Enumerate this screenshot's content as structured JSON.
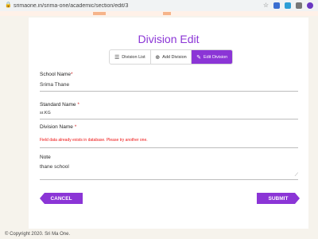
{
  "browser": {
    "url": "srimaone.in/srima-one/academic/section/edit/3"
  },
  "page": {
    "title": "Division Edit",
    "tabs": [
      {
        "label": "Division List",
        "icon": "list-icon"
      },
      {
        "label": "Add Division",
        "icon": "plus-circle-icon"
      },
      {
        "label": "Edit Division",
        "icon": "edit-icon"
      }
    ],
    "fields": {
      "school_name": {
        "label": "School Name",
        "required": "*",
        "value": "Srima Thane"
      },
      "standard_name": {
        "label": "Standard Name",
        "required": "*",
        "value": "sr.KG"
      },
      "division_name": {
        "label": "Division Name",
        "required": "*",
        "error": "Field data already exists in database. Please try another one."
      },
      "note": {
        "label": "Note",
        "value": "thane school"
      }
    },
    "cancel_label": "CANCEL",
    "submit_label": "SUBMIT"
  },
  "footer": {
    "copyright": "© Copyright 2020. Sri Ma One."
  },
  "colors": {
    "accent": "#8b35d6",
    "error": "#e11111"
  }
}
